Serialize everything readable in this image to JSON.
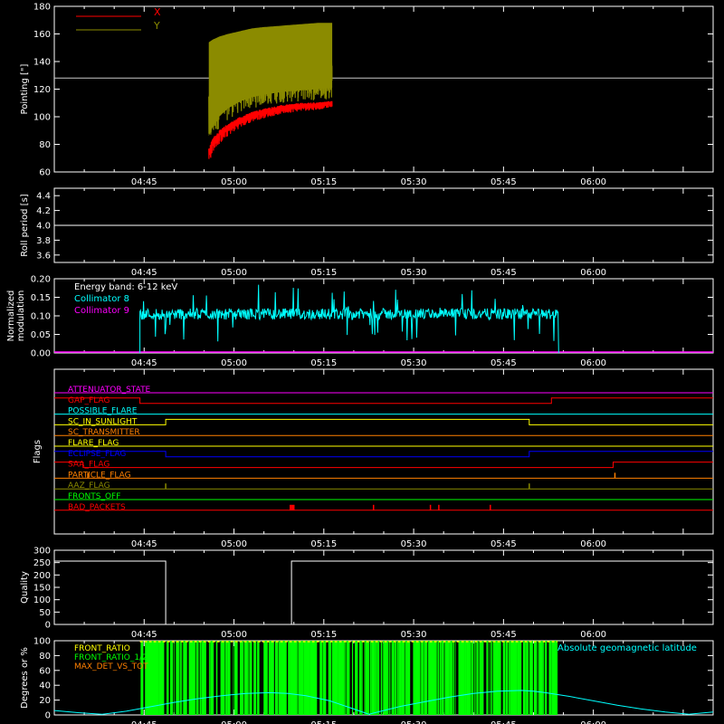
{
  "chart_data": [
    {
      "id": "pointing",
      "type": "line",
      "ylabel": "Pointing [\"]",
      "ylim": [
        60,
        180
      ],
      "yticks": [
        60,
        80,
        100,
        120,
        140,
        160,
        180
      ],
      "xlim": [
        279,
        370
      ],
      "xticks": [
        "04:45",
        "05:00",
        "05:15",
        "05:30",
        "05:45",
        "06:00"
      ],
      "xtick_minutes": [
        285,
        300,
        315,
        330,
        345,
        360
      ],
      "reference_line": 128,
      "series": [
        {
          "name": "X",
          "color": "#ff0000",
          "start_min": 295.8,
          "end_min": 316.4,
          "envelope": {
            "t_minutes": [
              295.8,
              296.5,
              297.5,
              299,
              301,
              303,
              305,
              308,
              311,
              314,
              316.4
            ],
            "low": [
              66,
              75,
              80,
              86,
              92,
              96,
              99,
              102,
              104,
              105,
              107
            ],
            "high": [
              88,
              95,
              100,
              104,
              108,
              111,
              113,
              115,
              116,
              116,
              116
            ]
          }
        },
        {
          "name": "Y",
          "color": "#8b8b00",
          "start_min": 295.8,
          "end_min": 316.4,
          "envelope": {
            "t_minutes": [
              295.8,
              296.5,
              297.5,
              299,
              301,
              303,
              305,
              308,
              311,
              314,
              316.4
            ],
            "low": [
              78,
              85,
              92,
              98,
              103,
              106,
              108,
              110,
              111,
              112,
              113
            ],
            "high": [
              158,
              160,
              162,
              164,
              166,
              168,
              169,
              170,
              171,
              172,
              172
            ]
          }
        }
      ]
    },
    {
      "id": "roll",
      "type": "line",
      "ylabel": "Roll period [s]",
      "ylim": [
        3.5,
        4.5
      ],
      "yticks": [
        3.6,
        3.8,
        4.0,
        4.2,
        4.4
      ],
      "ytick_labels": [
        "3.6",
        "3.8",
        "4.0",
        "4.2",
        "4.4"
      ],
      "value": 4.0
    },
    {
      "id": "modulation",
      "type": "line",
      "ylabel": "Normalized modulation",
      "ylim": [
        0,
        0.2
      ],
      "yticks": [
        0,
        0.05,
        0.1,
        0.15,
        0.2
      ],
      "ytick_labels": [
        "0.00",
        "0.05",
        "0.10",
        "0.15",
        "0.20"
      ],
      "annotation": "Energy band: 6-12 keV",
      "series": [
        {
          "name": "Collimator 8",
          "color": "#00ffff",
          "start_min": 284.3,
          "end_min": 354.2,
          "mean": 0.105,
          "spread": 0.015
        },
        {
          "name": "Collimator 9",
          "color": "#ff00ff",
          "value": 0.0
        }
      ]
    },
    {
      "id": "flags",
      "type": "line",
      "ylabel": "Flags",
      "flags": [
        {
          "name": "ATTENUATOR_STATE",
          "color": "#ff00ff",
          "segments": [
            [
              270,
              0,
              380
            ]
          ]
        },
        {
          "name": "GAP_FLAG",
          "color": "#ff0000",
          "segments": [
            [
              270,
              1,
              284.3
            ],
            [
              284.3,
              0,
              353
            ],
            [
              353,
              1,
              380
            ]
          ]
        },
        {
          "name": "POSSIBLE_FLARE",
          "color": "#00ffff",
          "segments": [
            [
              270,
              0,
              380
            ]
          ]
        },
        {
          "name": "SC_IN_SUNLIGHT",
          "color": "#ffff00",
          "segments": [
            [
              270,
              0,
              288.6
            ],
            [
              288.6,
              1,
              349.3
            ],
            [
              349.3,
              0,
              380
            ]
          ]
        },
        {
          "name": "SC_TRANSMITTER",
          "color": "#ff8000",
          "segments": [
            [
              270,
              0,
              380
            ]
          ]
        },
        {
          "name": "FLARE_FLAG",
          "color": "#ffff00",
          "segments": [
            [
              270,
              0,
              380
            ]
          ]
        },
        {
          "name": "ECLIPSE_FLAG",
          "color": "#0000ff",
          "segments": [
            [
              270,
              1,
              288.6
            ],
            [
              288.6,
              0,
              349.3
            ],
            [
              349.3,
              1,
              380
            ]
          ]
        },
        {
          "name": "SAA_FLAG",
          "color": "#ff0000",
          "segments": [
            [
              270,
              1,
              274.8
            ],
            [
              274.8,
              0,
              363.3
            ],
            [
              363.3,
              1,
              380
            ]
          ]
        },
        {
          "name": "PARTICLE_FLAG",
          "color": "#ff8000",
          "segments": [
            [
              270,
              0,
              380
            ]
          ],
          "spikes": [
            275.6,
            363.6
          ]
        },
        {
          "name": "AAZ_FLAG",
          "color": "#8b8b00",
          "segments": [
            [
              270,
              0,
              380
            ]
          ],
          "spikes": [
            288.6,
            349.3
          ]
        },
        {
          "name": "FRONTS_OFF",
          "color": "#00ff00",
          "segments": [
            [
              270,
              0,
              380
            ]
          ]
        },
        {
          "name": "BAD_PACKETS",
          "color": "#ff0000",
          "segments": [
            [
              270,
              0,
              380
            ]
          ],
          "spikes": [
            309.4,
            309.6,
            309.8,
            310.0,
            323.3,
            332.8,
            334.2,
            342.8
          ]
        }
      ]
    },
    {
      "id": "quality",
      "type": "line",
      "ylabel": "Quality",
      "ylim": [
        0,
        300
      ],
      "yticks": [
        0,
        50,
        100,
        150,
        200,
        250,
        300
      ],
      "segments": [
        [
          270,
          256,
          288.6
        ],
        [
          288.6,
          0,
          309.6
        ],
        [
          309.6,
          256,
          380
        ]
      ]
    },
    {
      "id": "lower",
      "type": "line",
      "ylabel": "Degrees or %",
      "ylim": [
        0,
        100
      ],
      "yticks": [
        0,
        20,
        40,
        60,
        80,
        100
      ],
      "series": [
        {
          "name": "FRONT_RATIO",
          "color": "#ffff00"
        },
        {
          "name": "FRONT_RATIO_1/2",
          "color": "#00ff00",
          "start_min": 284.3,
          "end_min": 354.0
        },
        {
          "name": "MAX_DET_VS_TOT",
          "color": "#ff8000"
        },
        {
          "name": "Absolute geomagnetic latitude",
          "color": "#00ffff",
          "x_minutes": [
            270,
            274,
            278,
            282,
            286,
            290,
            294,
            298,
            302,
            306,
            309,
            312,
            316,
            320,
            322.5,
            325,
            328,
            332,
            336,
            340,
            344,
            348,
            350,
            352,
            356,
            360,
            364,
            368,
            372,
            376,
            380
          ],
          "values": [
            6,
            3,
            1,
            5,
            11,
            17,
            22,
            26,
            29,
            30,
            29,
            26,
            19,
            8,
            1,
            6,
            12,
            18,
            24,
            29,
            32,
            33,
            32,
            30,
            25,
            19,
            13,
            8,
            4,
            1,
            4
          ]
        }
      ]
    }
  ]
}
